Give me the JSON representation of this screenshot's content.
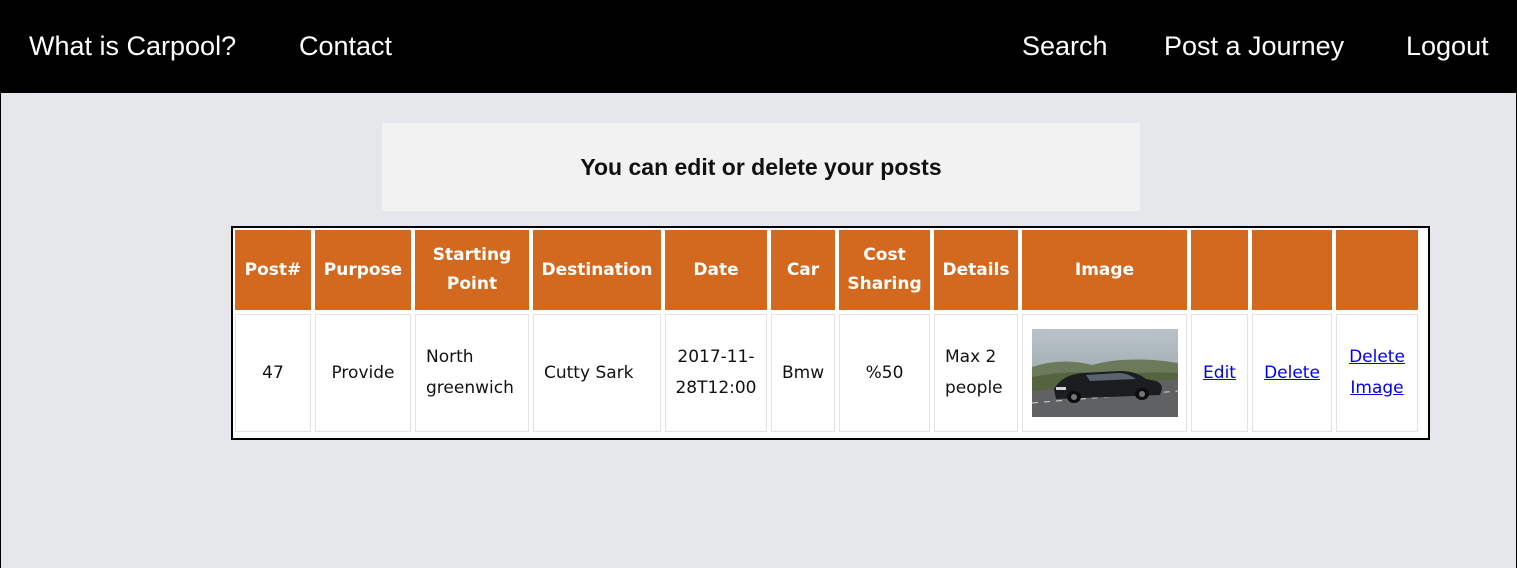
{
  "nav": {
    "left": [
      "What is Carpool?",
      "Contact"
    ],
    "right": [
      "Search",
      "Post a Journey",
      "Logout"
    ]
  },
  "banner": {
    "title": "You can edit or delete your posts"
  },
  "table": {
    "headers": [
      "Post#",
      "Purpose",
      "Starting Point",
      "Destination",
      "Date",
      "Car",
      "Cost Sharing",
      "Details",
      "Image",
      "",
      "",
      ""
    ],
    "rows": [
      {
        "post": "47",
        "purpose": "Provide",
        "starting_point": "North greenwich",
        "destination": "Cutty Sark",
        "date": "2017-11-28T12:00",
        "car": "Bmw",
        "cost_sharing": "%50",
        "details": "Max 2 people",
        "image": "car-photo",
        "edit": "Edit",
        "delete": "Delete",
        "delete_image": "Delete Image"
      }
    ]
  },
  "colors": {
    "header_bg": "#d2691e",
    "nav_bg": "#000000",
    "page_bg": "#e6e7eb",
    "link": "#0000ee"
  }
}
